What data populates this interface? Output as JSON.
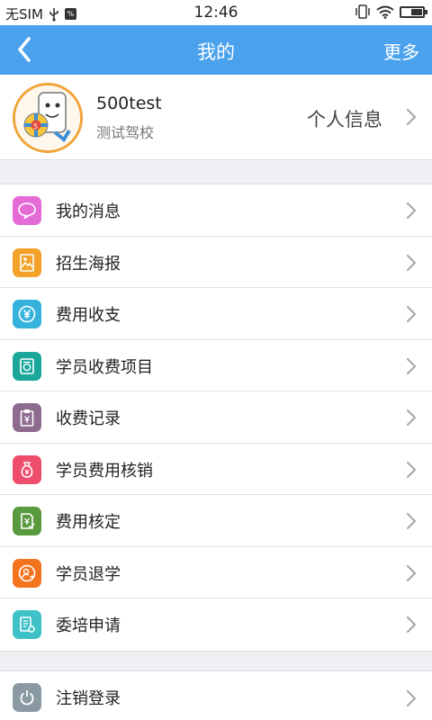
{
  "status_bar": {
    "carrier": "无SIM",
    "time": "12:46"
  },
  "nav": {
    "title": "我的",
    "more_label": "更多"
  },
  "profile": {
    "name": "500test",
    "school": "测试驾校",
    "info_label": "个人信息"
  },
  "menu": {
    "items": [
      {
        "label": "我的消息",
        "icon": "message-icon",
        "color": "#e46bd6"
      },
      {
        "label": "招生海报",
        "icon": "poster-icon",
        "color": "#f3a128"
      },
      {
        "label": "费用收支",
        "icon": "yuan-coin-icon",
        "color": "#37b3db"
      },
      {
        "label": "学员收费项目",
        "icon": "fee-item-icon",
        "color": "#1aa79a"
      },
      {
        "label": "收费记录",
        "icon": "clipboard-yuan-icon",
        "color": "#8e6b8f"
      },
      {
        "label": "学员费用核销",
        "icon": "money-bag-icon",
        "color": "#ef4d6c"
      },
      {
        "label": "费用核定",
        "icon": "document-check-icon",
        "color": "#5a9a3e"
      },
      {
        "label": "学员退学",
        "icon": "user-leave-icon",
        "color": "#f4731f"
      },
      {
        "label": "委培申请",
        "icon": "application-form-icon",
        "color": "#3fc2c7"
      }
    ]
  },
  "logout": {
    "label": "注销登录",
    "icon": "power-icon",
    "color": "#8a9aa3"
  }
}
